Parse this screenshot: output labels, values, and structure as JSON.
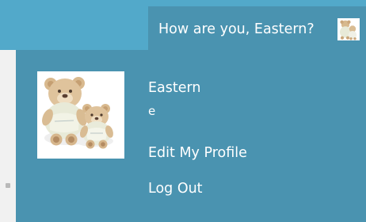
{
  "header": {
    "greeting": "How are you, Eastern?",
    "avatar_icon": "teddy-bear-avatar"
  },
  "account": {
    "display_name": "Eastern",
    "username": "e",
    "avatar_icon": "teddy-bear-avatar"
  },
  "menu": {
    "edit_profile": "Edit My Profile",
    "log_out": "Log Out"
  },
  "colors": {
    "bar": "#52a9ca",
    "dropdown": "#4a93b0",
    "text": "#ffffff"
  }
}
